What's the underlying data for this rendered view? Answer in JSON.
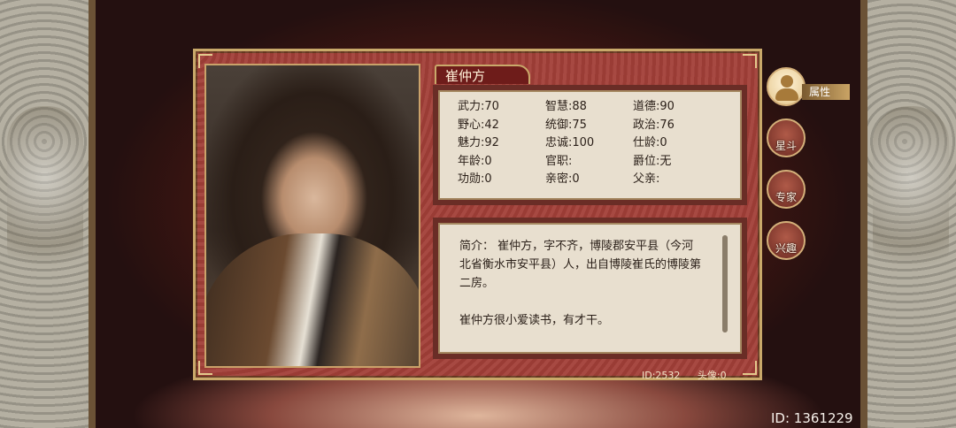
{
  "character": {
    "name": "崔仲方"
  },
  "stats": [
    {
      "label": "武力",
      "value": "70"
    },
    {
      "label": "智慧",
      "value": "88"
    },
    {
      "label": "道德",
      "value": "90"
    },
    {
      "label": "野心",
      "value": "42"
    },
    {
      "label": "统御",
      "value": "75"
    },
    {
      "label": "政治",
      "value": "76"
    },
    {
      "label": "魅力",
      "value": "92"
    },
    {
      "label": "忠诚",
      "value": "100"
    },
    {
      "label": "仕龄",
      "value": "0"
    },
    {
      "label": "年龄",
      "value": "0"
    },
    {
      "label": "官职",
      "value": ""
    },
    {
      "label": "爵位",
      "value": "无"
    },
    {
      "label": "功勋",
      "value": "0"
    },
    {
      "label": "亲密",
      "value": "0"
    },
    {
      "label": "父亲",
      "value": ""
    }
  ],
  "stat_text": [
    "武力:70",
    "智慧:88",
    "道德:90",
    "野心:42",
    "统御:75",
    "政治:76",
    "魅力:92",
    "忠诚:100",
    "仕龄:0",
    "年龄:0",
    "官职:",
    "爵位:无",
    "功勋:0",
    "亲密:0",
    "父亲:"
  ],
  "bio": {
    "paragraph1": "简介：  崔仲方，字不齐，博陵郡安平县（今河北省衡水市安平县）人，出自博陵崔氏的博陵第二房。",
    "paragraph2": "崔仲方很小爱读书，有才干。"
  },
  "meta": {
    "id": "ID:2532",
    "avatar": "头像:0"
  },
  "side_menu": {
    "items": [
      {
        "label": "属性",
        "icon": "user-icon",
        "active": true
      },
      {
        "label": "星斗",
        "icon": "star-icon",
        "active": false
      },
      {
        "label": "专家",
        "icon": "flame-icon",
        "active": false
      },
      {
        "label": "兴趣",
        "icon": "face-icon",
        "active": false
      }
    ]
  },
  "footer": {
    "player_id": "ID: 1361229"
  },
  "colors": {
    "dialog_red": "#a23f38",
    "gold_border": "#c9a96a",
    "paper": "#e8dfcf"
  }
}
